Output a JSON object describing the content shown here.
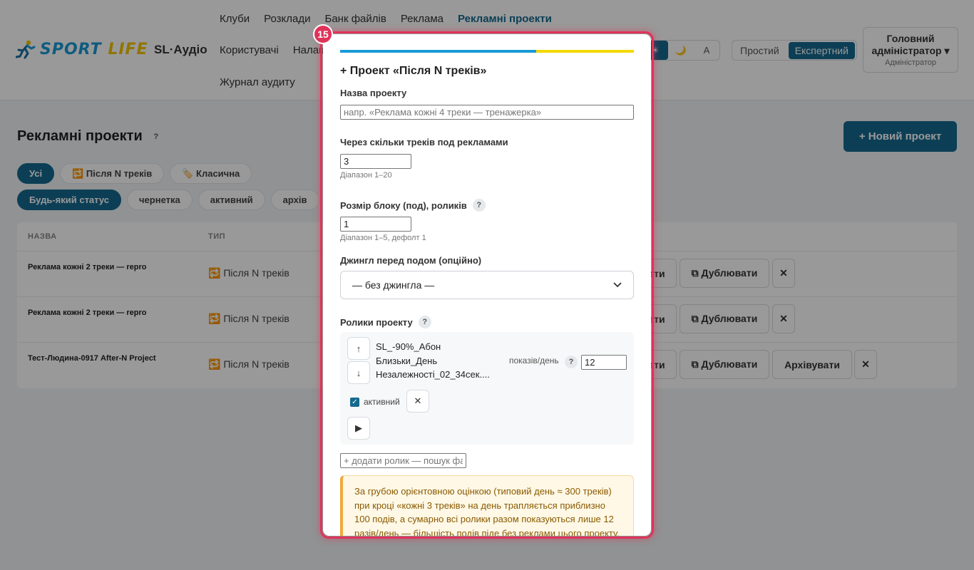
{
  "header": {
    "logo_sport": "SPORT",
    "logo_life": "LIFE",
    "app_name": "SL·Аудіо",
    "nav_row1": [
      "Клуби",
      "Розклади",
      "Банк файлів",
      "Реклама",
      "Рекламні проекти"
    ],
    "nav_row2": [
      "Користувачі",
      "Налаш"
    ],
    "nav_row3": [
      "Журнал аудиту"
    ],
    "theme_buttons": [
      "☀",
      "🌙",
      "A"
    ],
    "mode_simple": "Простий",
    "mode_expert": "Експертний",
    "user_name": "Головний адміністратор ▾",
    "user_role": "Адміністратор"
  },
  "page": {
    "title": "Рекламні проекти",
    "help": "?",
    "new_button": "+ Новий проект",
    "type_filters": [
      "Усі",
      "🔁 Після N треків",
      "🏷️ Класична"
    ],
    "status_filters": [
      "Будь-який статус",
      "чернетка",
      "активний",
      "архів"
    ],
    "table": {
      "headers": [
        "НАЗВА",
        "ТИП"
      ],
      "rows": [
        {
          "name": "Реклама кожні 2 треки — repro",
          "type": "🔁 Після N треків",
          "edit": "ати",
          "duplicate": "⧉ Дублювати",
          "archive": "",
          "delete": "✕"
        },
        {
          "name": "Реклама кожні 2 треки — repro",
          "type": "🔁 Після N треків",
          "edit": "ати",
          "duplicate": "⧉ Дублювати",
          "archive": "",
          "delete": "✕"
        },
        {
          "name": "Тест-Людина-0917 After-N Project",
          "type": "🔁 Після N треків",
          "edit": "ати",
          "duplicate": "⧉ Дублювати",
          "archive": "Архівувати",
          "delete": "✕"
        }
      ]
    }
  },
  "modal": {
    "badge": "15",
    "title": "+ Проект «Після N треків»",
    "name_label": "Назва проекту",
    "name_placeholder": "напр. «Реклама кожні 4 треки — тренажерка»",
    "every_label": "Через скільки треків под рекламами",
    "every_value": "3",
    "every_hint": "Діапазон 1–20",
    "pod_label": "Розмір блоку (под), роликів",
    "pod_help": "?",
    "pod_value": "1",
    "pod_hint": "Діапазон 1–5, дефолт 1",
    "jingle_label": "Джингл перед подом (опційно)",
    "jingle_value": "— без джингла —",
    "clips_label": "Ролики проекту",
    "clips_help": "?",
    "clip": {
      "up": "↑",
      "down": "↓",
      "name": "SL_-90%_Абон Близьки_День Незалежності_02_34сек....",
      "per_day_label": "показів/день",
      "per_day_help": "?",
      "per_day_value": "12",
      "active_label": "активний",
      "remove": "✕",
      "play": "▶"
    },
    "add_clip_placeholder": "+ додати ролик — пошук фа",
    "warning": "За грубою орієнтовною оцінкою (типовий день ≈ 300 треків) при кроці «кожні 3 треків» на день трапляється приблизно 100 подів, а сумарно всі ролики разом показуються лише 12 разів/день — більшість подів піде без реклами цього проекту."
  }
}
